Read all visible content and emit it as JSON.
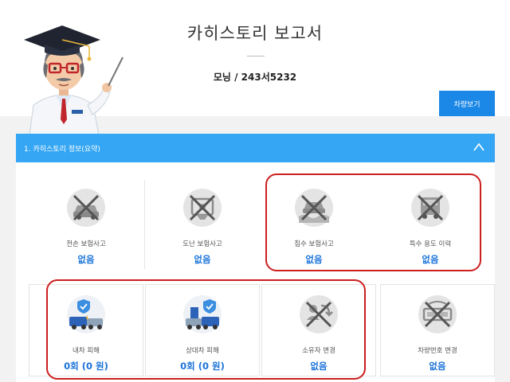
{
  "header": {
    "title": "카히스토리 보고서",
    "plate": "모닝 / 243서5232",
    "history_button": "차량보기"
  },
  "section": {
    "title": "1. 카히스토리 정보(요약)"
  },
  "cards": [
    {
      "label": "전손 보험사고",
      "value": "없음",
      "icon": "crossed-car-total-loss-icon"
    },
    {
      "label": "도난 보험사고",
      "value": "없음",
      "icon": "crossed-car-theft-icon"
    },
    {
      "label": "침수 보험사고",
      "value": "없음",
      "icon": "crossed-car-flood-icon"
    },
    {
      "label": "특수 용도 이력",
      "value": "없음",
      "icon": "crossed-car-special-use-icon"
    },
    {
      "label": "내차 피해",
      "value": "0회 (0 원)",
      "icon": "car-collision-shield-icon"
    },
    {
      "label": "상대차 피해",
      "value": "0회 (0 원)",
      "icon": "car-collision-shield-other-icon"
    },
    {
      "label": "소유자 변경",
      "value": "없음",
      "icon": "crossed-owner-change-icon"
    },
    {
      "label": "차량번호 변경",
      "value": "없음",
      "icon": "crossed-plate-change-icon"
    }
  ],
  "colors": {
    "accent": "#1b87e6",
    "section_bar": "#35a6f4",
    "value_text": "#1a73d9",
    "highlight": "#cc1f1f"
  }
}
